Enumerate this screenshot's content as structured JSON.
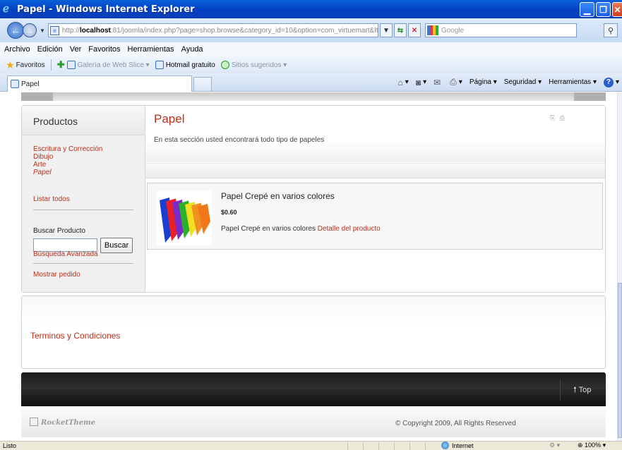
{
  "window": {
    "title": "Papel - Windows Internet Explorer"
  },
  "address": {
    "url_prefix": "http://",
    "url_host": "localhost",
    "url_rest": ":81/joomla/index.php?page=shop.browse&category_id=10&option=com_virtuemart&Itemid=34",
    "search_placeholder": "Google"
  },
  "menu": [
    "Archivo",
    "Edición",
    "Ver",
    "Favoritos",
    "Herramientas",
    "Ayuda"
  ],
  "favorites": {
    "label": "Favoritos",
    "items": [
      {
        "label": "Galería de Web Slice ▾",
        "dim": true
      },
      {
        "label": "Hotmail gratuito",
        "dim": false
      },
      {
        "label": "Sitios sugeridos ▾",
        "dim": true
      }
    ]
  },
  "tab": {
    "label": "Papel"
  },
  "commands": {
    "page": "Página ▾",
    "security": "Seguridad ▾",
    "tools": "Herramientas ▾"
  },
  "sidebar": {
    "title": "Productos",
    "categories": [
      {
        "label": "Escritura y Corrección",
        "current": false
      },
      {
        "label": "Dibujo",
        "current": false
      },
      {
        "label": "Arte",
        "current": false
      },
      {
        "label": "Papel",
        "current": true
      }
    ],
    "list_all": "Listar todos",
    "search_label": "Buscar Producto",
    "search_button": "Buscar",
    "advanced_search": "Búsqueda Avanzada",
    "show_order": "Mostrar pedido"
  },
  "content": {
    "title": "Papel",
    "description": "En esta sección usted encontrará todo tipo de papeles",
    "product": {
      "name": "Papel Crepé en varios colores",
      "price": "$0.60",
      "short_desc": "Papel Crepé en varios colores",
      "detail_link": "Detalle del producto",
      "image_colors": [
        "#1a3fd0",
        "#e8202a",
        "#7a2ac8",
        "#2ab02a",
        "#f0e020",
        "#f09020",
        "#f07818"
      ]
    }
  },
  "bottom": {
    "terms": "Terminos y Condiciones"
  },
  "footer": {
    "top": "Top",
    "brand": "RocketTheme",
    "copyright": "© Copyright 2009, All Rights Reserved"
  },
  "status": {
    "text": "Listo",
    "zone": "Internet",
    "zoom": "100%"
  },
  "colors": {
    "link": "#b8301c",
    "titlebar": "#0343c6"
  }
}
